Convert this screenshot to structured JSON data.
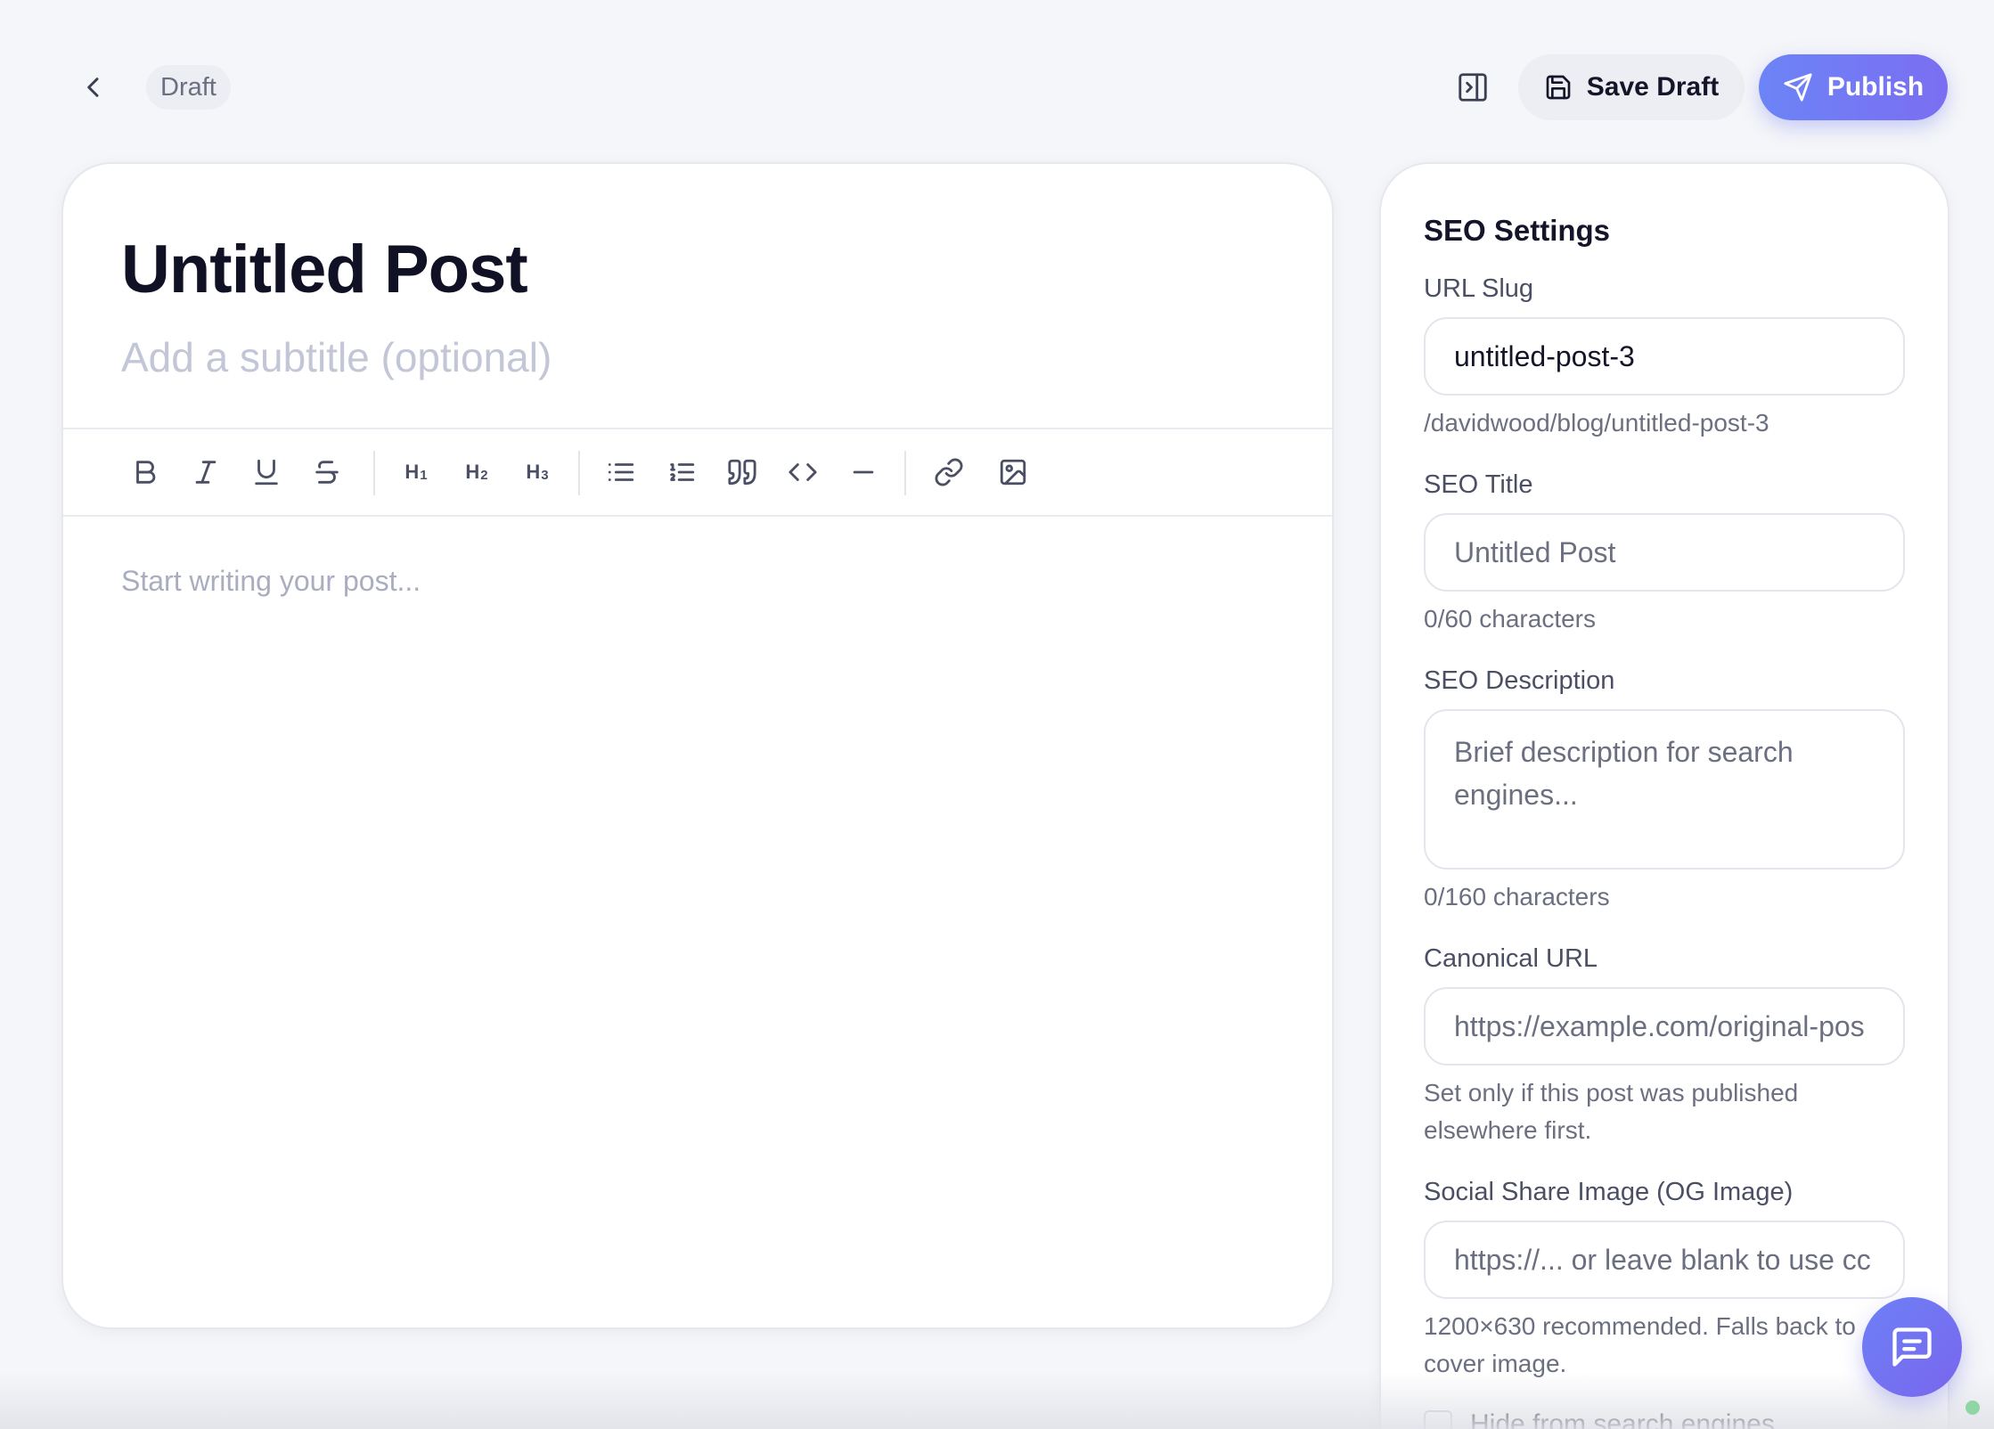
{
  "header": {
    "status_badge": "Draft",
    "save_draft_label": "Save Draft",
    "publish_label": "Publish"
  },
  "editor": {
    "title": "Untitled Post",
    "subtitle_placeholder": "Add a subtitle (optional)",
    "body_placeholder": "Start writing your post...",
    "toolbar": {
      "h1": "H",
      "h1_level": "1",
      "h2": "H",
      "h2_level": "2",
      "h3": "H",
      "h3_level": "3"
    }
  },
  "seo": {
    "heading": "SEO Settings",
    "url_slug": {
      "label": "URL Slug",
      "value": "untitled-post-3",
      "hint": "/davidwood/blog/untitled-post-3"
    },
    "seo_title": {
      "label": "SEO Title",
      "placeholder": "Untitled Post",
      "hint": "0/60 characters"
    },
    "seo_description": {
      "label": "SEO Description",
      "placeholder": "Brief description for search engines...",
      "hint": "0/160 characters"
    },
    "canonical_url": {
      "label": "Canonical URL",
      "placeholder": "https://example.com/original-pos",
      "hint": "Set only if this post was published elsewhere first."
    },
    "og_image": {
      "label": "Social Share Image (OG Image)",
      "placeholder": "https://... or leave blank to use cc",
      "hint": "1200×630 recommended. Falls back to cover image."
    },
    "hide_from_search": {
      "label": "Hide from search engines"
    }
  },
  "colors": {
    "accent": "#6c84f6",
    "background": "#f5f6f9"
  },
  "icons": {
    "back": "chevron-left-icon",
    "panel_toggle": "panel-right-icon",
    "save": "floppy-disk-icon",
    "publish": "send-icon",
    "chat": "message-square-icon"
  }
}
